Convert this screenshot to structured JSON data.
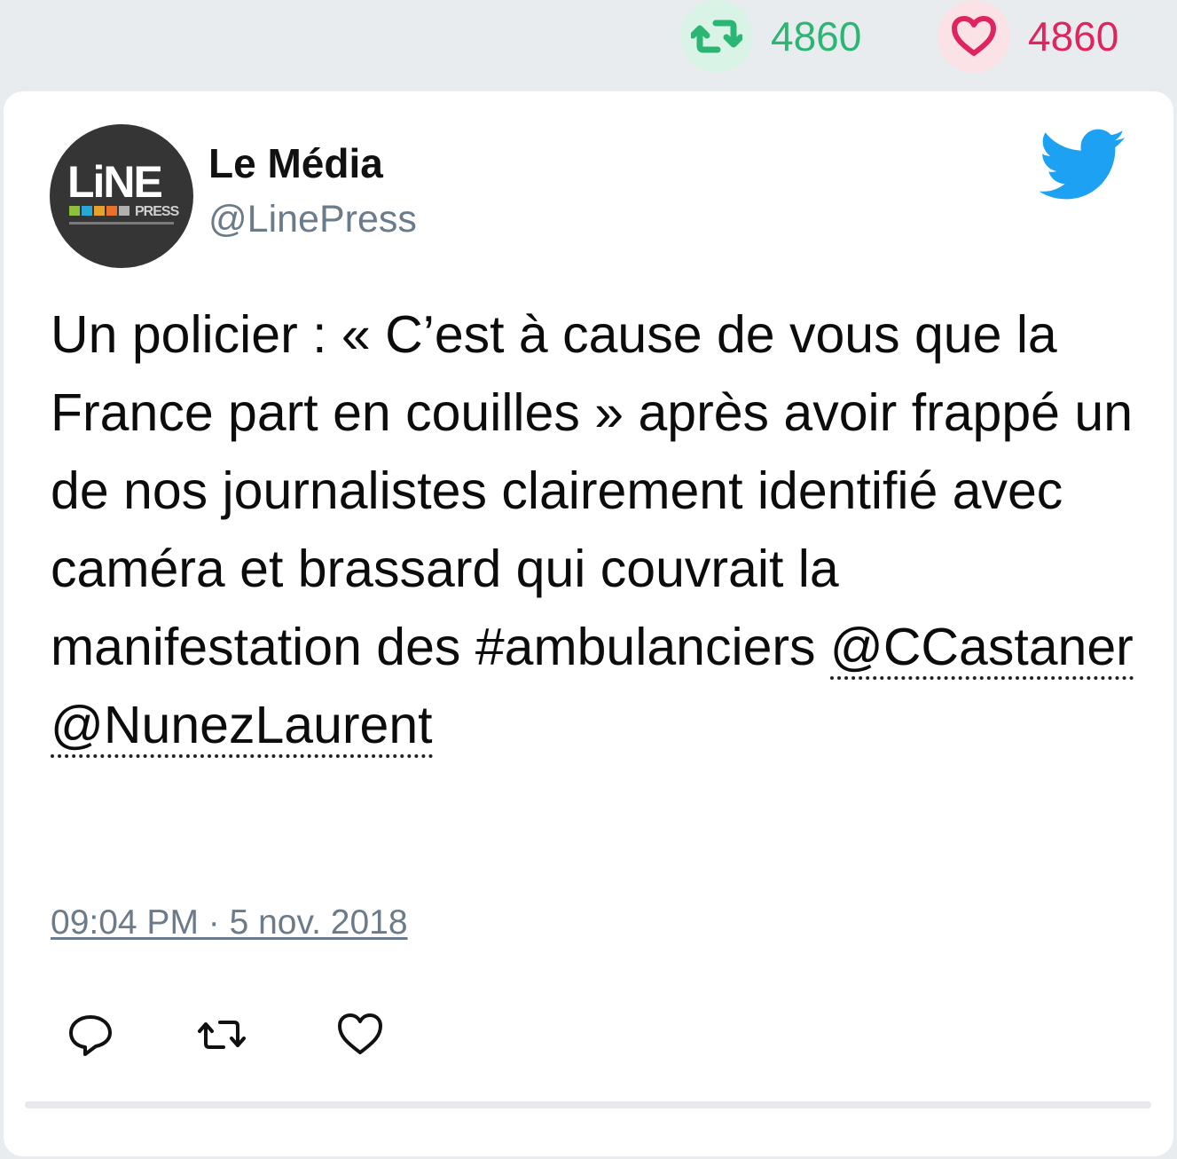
{
  "stats": {
    "retweets": "4860",
    "likes": "4860"
  },
  "tweet": {
    "display_name": "Le Média",
    "handle": "@LinePress",
    "avatar_logo": "LiNE PRESS",
    "text_before": "Un policier : « C’est à cause de vous que la France part en couilles » après avoir frappé un de nos journalistes clairement identifié avec caméra et brassard qui couvrait la manifestation des #ambulanciers ",
    "mentions": [
      "@CCastaner",
      "@NunezLaurent"
    ],
    "timestamp": "09:04 PM · 5 nov. 2018"
  },
  "icons": {
    "brand": "twitter-bird-icon",
    "reply": "reply-icon",
    "retweet": "retweet-icon",
    "like": "heart-icon"
  },
  "colors": {
    "retweet_green": "#2bb673",
    "like_red": "#e0245e",
    "twitter_blue": "#1da1f2",
    "handle_gray": "#6b7b8a"
  }
}
